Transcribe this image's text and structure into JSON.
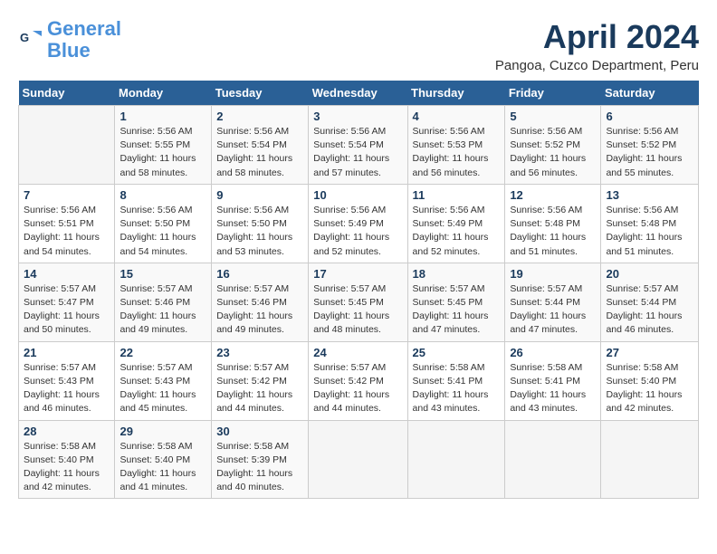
{
  "logo": {
    "line1": "General",
    "line2": "Blue"
  },
  "title": "April 2024",
  "location": "Pangoa, Cuzco Department, Peru",
  "days_of_week": [
    "Sunday",
    "Monday",
    "Tuesday",
    "Wednesday",
    "Thursday",
    "Friday",
    "Saturday"
  ],
  "weeks": [
    [
      {
        "num": "",
        "info": ""
      },
      {
        "num": "1",
        "info": "Sunrise: 5:56 AM\nSunset: 5:55 PM\nDaylight: 11 hours\nand 58 minutes."
      },
      {
        "num": "2",
        "info": "Sunrise: 5:56 AM\nSunset: 5:54 PM\nDaylight: 11 hours\nand 58 minutes."
      },
      {
        "num": "3",
        "info": "Sunrise: 5:56 AM\nSunset: 5:54 PM\nDaylight: 11 hours\nand 57 minutes."
      },
      {
        "num": "4",
        "info": "Sunrise: 5:56 AM\nSunset: 5:53 PM\nDaylight: 11 hours\nand 56 minutes."
      },
      {
        "num": "5",
        "info": "Sunrise: 5:56 AM\nSunset: 5:52 PM\nDaylight: 11 hours\nand 56 minutes."
      },
      {
        "num": "6",
        "info": "Sunrise: 5:56 AM\nSunset: 5:52 PM\nDaylight: 11 hours\nand 55 minutes."
      }
    ],
    [
      {
        "num": "7",
        "info": "Sunrise: 5:56 AM\nSunset: 5:51 PM\nDaylight: 11 hours\nand 54 minutes."
      },
      {
        "num": "8",
        "info": "Sunrise: 5:56 AM\nSunset: 5:50 PM\nDaylight: 11 hours\nand 54 minutes."
      },
      {
        "num": "9",
        "info": "Sunrise: 5:56 AM\nSunset: 5:50 PM\nDaylight: 11 hours\nand 53 minutes."
      },
      {
        "num": "10",
        "info": "Sunrise: 5:56 AM\nSunset: 5:49 PM\nDaylight: 11 hours\nand 52 minutes."
      },
      {
        "num": "11",
        "info": "Sunrise: 5:56 AM\nSunset: 5:49 PM\nDaylight: 11 hours\nand 52 minutes."
      },
      {
        "num": "12",
        "info": "Sunrise: 5:56 AM\nSunset: 5:48 PM\nDaylight: 11 hours\nand 51 minutes."
      },
      {
        "num": "13",
        "info": "Sunrise: 5:56 AM\nSunset: 5:48 PM\nDaylight: 11 hours\nand 51 minutes."
      }
    ],
    [
      {
        "num": "14",
        "info": "Sunrise: 5:57 AM\nSunset: 5:47 PM\nDaylight: 11 hours\nand 50 minutes."
      },
      {
        "num": "15",
        "info": "Sunrise: 5:57 AM\nSunset: 5:46 PM\nDaylight: 11 hours\nand 49 minutes."
      },
      {
        "num": "16",
        "info": "Sunrise: 5:57 AM\nSunset: 5:46 PM\nDaylight: 11 hours\nand 49 minutes."
      },
      {
        "num": "17",
        "info": "Sunrise: 5:57 AM\nSunset: 5:45 PM\nDaylight: 11 hours\nand 48 minutes."
      },
      {
        "num": "18",
        "info": "Sunrise: 5:57 AM\nSunset: 5:45 PM\nDaylight: 11 hours\nand 47 minutes."
      },
      {
        "num": "19",
        "info": "Sunrise: 5:57 AM\nSunset: 5:44 PM\nDaylight: 11 hours\nand 47 minutes."
      },
      {
        "num": "20",
        "info": "Sunrise: 5:57 AM\nSunset: 5:44 PM\nDaylight: 11 hours\nand 46 minutes."
      }
    ],
    [
      {
        "num": "21",
        "info": "Sunrise: 5:57 AM\nSunset: 5:43 PM\nDaylight: 11 hours\nand 46 minutes."
      },
      {
        "num": "22",
        "info": "Sunrise: 5:57 AM\nSunset: 5:43 PM\nDaylight: 11 hours\nand 45 minutes."
      },
      {
        "num": "23",
        "info": "Sunrise: 5:57 AM\nSunset: 5:42 PM\nDaylight: 11 hours\nand 44 minutes."
      },
      {
        "num": "24",
        "info": "Sunrise: 5:57 AM\nSunset: 5:42 PM\nDaylight: 11 hours\nand 44 minutes."
      },
      {
        "num": "25",
        "info": "Sunrise: 5:58 AM\nSunset: 5:41 PM\nDaylight: 11 hours\nand 43 minutes."
      },
      {
        "num": "26",
        "info": "Sunrise: 5:58 AM\nSunset: 5:41 PM\nDaylight: 11 hours\nand 43 minutes."
      },
      {
        "num": "27",
        "info": "Sunrise: 5:58 AM\nSunset: 5:40 PM\nDaylight: 11 hours\nand 42 minutes."
      }
    ],
    [
      {
        "num": "28",
        "info": "Sunrise: 5:58 AM\nSunset: 5:40 PM\nDaylight: 11 hours\nand 42 minutes."
      },
      {
        "num": "29",
        "info": "Sunrise: 5:58 AM\nSunset: 5:40 PM\nDaylight: 11 hours\nand 41 minutes."
      },
      {
        "num": "30",
        "info": "Sunrise: 5:58 AM\nSunset: 5:39 PM\nDaylight: 11 hours\nand 40 minutes."
      },
      {
        "num": "",
        "info": ""
      },
      {
        "num": "",
        "info": ""
      },
      {
        "num": "",
        "info": ""
      },
      {
        "num": "",
        "info": ""
      }
    ]
  ]
}
